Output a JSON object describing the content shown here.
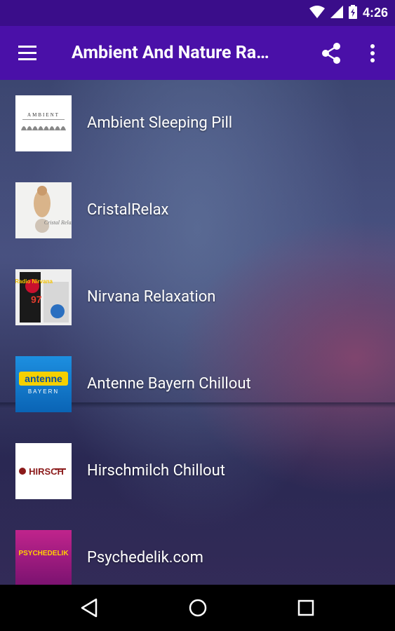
{
  "status_bar": {
    "time": "4:26"
  },
  "app_bar": {
    "title": "Ambient And Nature Ra…"
  },
  "stations": [
    {
      "name": "Ambient Sleeping Pill",
      "logo_text": "AMBIENT"
    },
    {
      "name": "CristalRelax",
      "logo_text": "Cristal Relax"
    },
    {
      "name": "Nirvana Relaxation",
      "logo_text": "Radio Nirvana"
    },
    {
      "name": "Antenne Bayern Chillout",
      "logo_text": "antenne",
      "logo_subtext": "BAYERN"
    },
    {
      "name": "Hirschmilch Chillout",
      "logo_text": "HIRSCH"
    },
    {
      "name": "Psychedelik.com",
      "logo_text": "PSYCHEDELIK"
    }
  ],
  "colors": {
    "status_bar": "#3a0d8a",
    "app_bar": "#4a10a8",
    "nav_bar": "#000000",
    "text": "#ffffff"
  }
}
